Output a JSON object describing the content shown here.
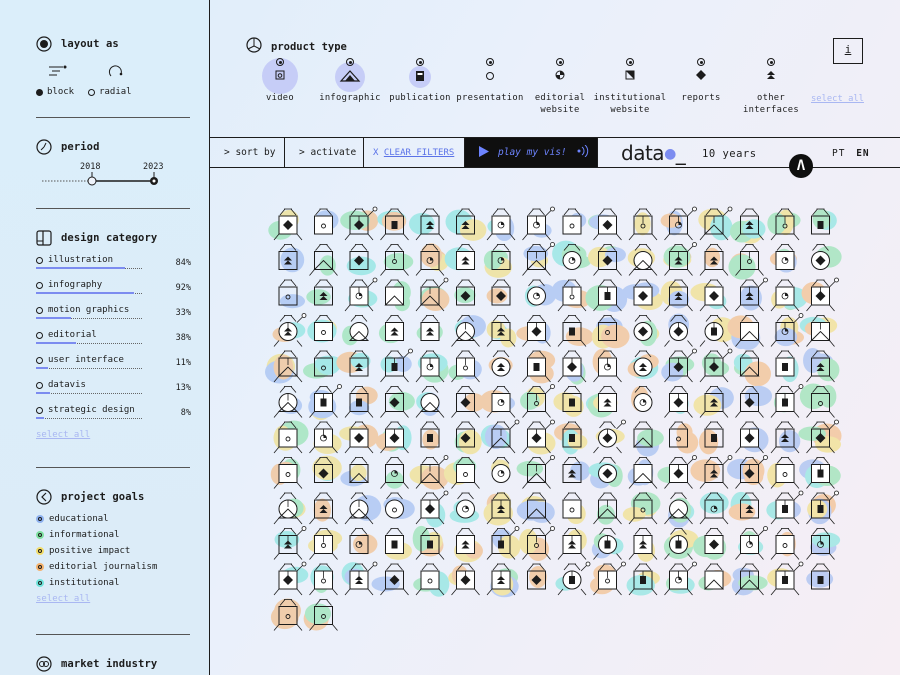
{
  "sidebar": {
    "layout": {
      "title": "layout as",
      "options": [
        "block",
        "radial"
      ],
      "selected": "block"
    },
    "period": {
      "title": "period",
      "start": "2018",
      "end": "2023"
    },
    "design_category": {
      "title": "design category",
      "items": [
        {
          "label": "illustration",
          "pct": "84%",
          "value": 0.84
        },
        {
          "label": "infography",
          "pct": "92%",
          "value": 0.92
        },
        {
          "label": "motion graphics",
          "pct": "33%",
          "value": 0.33
        },
        {
          "label": "editorial",
          "pct": "38%",
          "value": 0.38
        },
        {
          "label": "user interface",
          "pct": "11%",
          "value": 0.11
        },
        {
          "label": "datavis",
          "pct": "13%",
          "value": 0.13
        },
        {
          "label": "strategic design",
          "pct": "8%",
          "value": 0.08
        }
      ],
      "select_all": "select all"
    },
    "project_goals": {
      "title": "project goals",
      "items": [
        {
          "label": "educational",
          "color": "#8fb2f0"
        },
        {
          "label": "informational",
          "color": "#7ee0a0"
        },
        {
          "label": "positive impact",
          "color": "#f2dc6a"
        },
        {
          "label": "editorial journalism",
          "color": "#f4b26e"
        },
        {
          "label": "institutional",
          "color": "#6fe3da"
        }
      ],
      "select_all": "select all"
    },
    "market_industry": {
      "title": "market industry"
    }
  },
  "product_type": {
    "title": "product type",
    "items": [
      {
        "label": "video",
        "glyph": "video-icon",
        "active": true
      },
      {
        "label": "infographic",
        "glyph": "infographic-icon",
        "active": true
      },
      {
        "label": "publication",
        "glyph": "publication-icon",
        "active": true
      },
      {
        "label": "presentation",
        "glyph": "presentation-icon",
        "active": false
      },
      {
        "label": "editorial website",
        "glyph": "editorial-website-icon",
        "active": false
      },
      {
        "label": "institutional website",
        "glyph": "institutional-website-icon",
        "active": false
      },
      {
        "label": "reports",
        "glyph": "reports-icon",
        "active": false
      },
      {
        "label": "other interfaces",
        "glyph": "other-interfaces-icon",
        "active": false
      }
    ],
    "select_all": "select all",
    "info_label": "i"
  },
  "toolbar": {
    "sort_by": "> sort by",
    "activate": "> activate",
    "clear_prefix": "X ",
    "clear_filters": "CLEAR FILTERS",
    "play": "play my vis!",
    "brand": "data",
    "brand_sub": "10 years",
    "lang_pt": "PT",
    "lang_en": "EN",
    "scroll_top": "Λ"
  },
  "grid": {
    "columns": 16,
    "rows": 12,
    "count": 178
  },
  "colors": {
    "accent": "#5a72e8",
    "ink": "#1c1c1c"
  }
}
